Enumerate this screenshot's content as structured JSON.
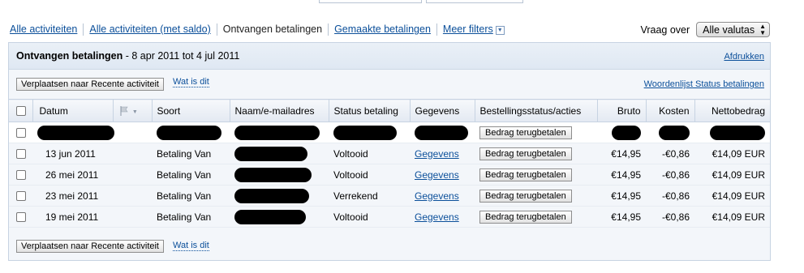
{
  "tabs": [
    {
      "label": "Alle activiteiten",
      "link": true
    },
    {
      "label": "Alle activiteiten (met saldo)",
      "link": true
    },
    {
      "label": "Ontvangen betalingen",
      "link": false
    },
    {
      "label": "Gemaakte betalingen",
      "link": true
    },
    {
      "label": "Meer filters",
      "link": true
    }
  ],
  "currency": {
    "label": "Vraag over",
    "selected": "Alle valutas"
  },
  "panel": {
    "title_bold": "Ontvangen betalingen",
    "title_range": " - 8 apr 2011 tot 4 jul 2011",
    "print_link": "Afdrukken",
    "move_button": "Verplaatsen naar Recente activiteit",
    "whatsthis": "Wat is dit",
    "glossary_link": "Woordenlijst Status betalingen"
  },
  "columns": [
    "Datum",
    "Soort",
    "Naam/e-mailadres",
    "Status betaling",
    "Gegevens",
    "Bestellingsstatus/acties",
    "Bruto",
    "Kosten",
    "Nettobedrag"
  ],
  "rows": [
    {
      "date": "",
      "type": "",
      "status": "",
      "details": "",
      "action": "Bedrag terugbetalen",
      "gross": "",
      "fee": "",
      "net": "",
      "redacted": true
    },
    {
      "date": "13 jun 2011",
      "type": "Betaling Van",
      "status": "Voltooid",
      "details": "Gegevens",
      "action": "Bedrag terugbetalen",
      "gross": "€14,95",
      "fee": "-€0,86",
      "net": "€14,09 EUR"
    },
    {
      "date": "26 mei 2011",
      "type": "Betaling Van",
      "status": "Voltooid",
      "details": "Gegevens",
      "action": "Bedrag terugbetalen",
      "gross": "€14,95",
      "fee": "-€0,86",
      "net": "€14,09 EUR"
    },
    {
      "date": "23 mei 2011",
      "type": "Betaling Van",
      "status": "Verrekend",
      "details": "Gegevens",
      "action": "Bedrag terugbetalen",
      "gross": "€14,95",
      "fee": "-€0,86",
      "net": "€14,09 EUR"
    },
    {
      "date": "19 mei 2011",
      "type": "Betaling Van",
      "status": "Voltooid",
      "details": "Gegevens",
      "action": "Bedrag terugbetalen",
      "gross": "€14,95",
      "fee": "-€0,86",
      "net": "€14,09 EUR"
    }
  ],
  "colors": {
    "link": "#0b4f9a",
    "panel_bg": "#f3f6fa",
    "panel_border": "#c7d3e2"
  },
  "icons": {
    "flag_column": "flag-icon",
    "filter_dropdown": "chevron-down-icon",
    "select_arrows": "updown-arrows-icon"
  }
}
